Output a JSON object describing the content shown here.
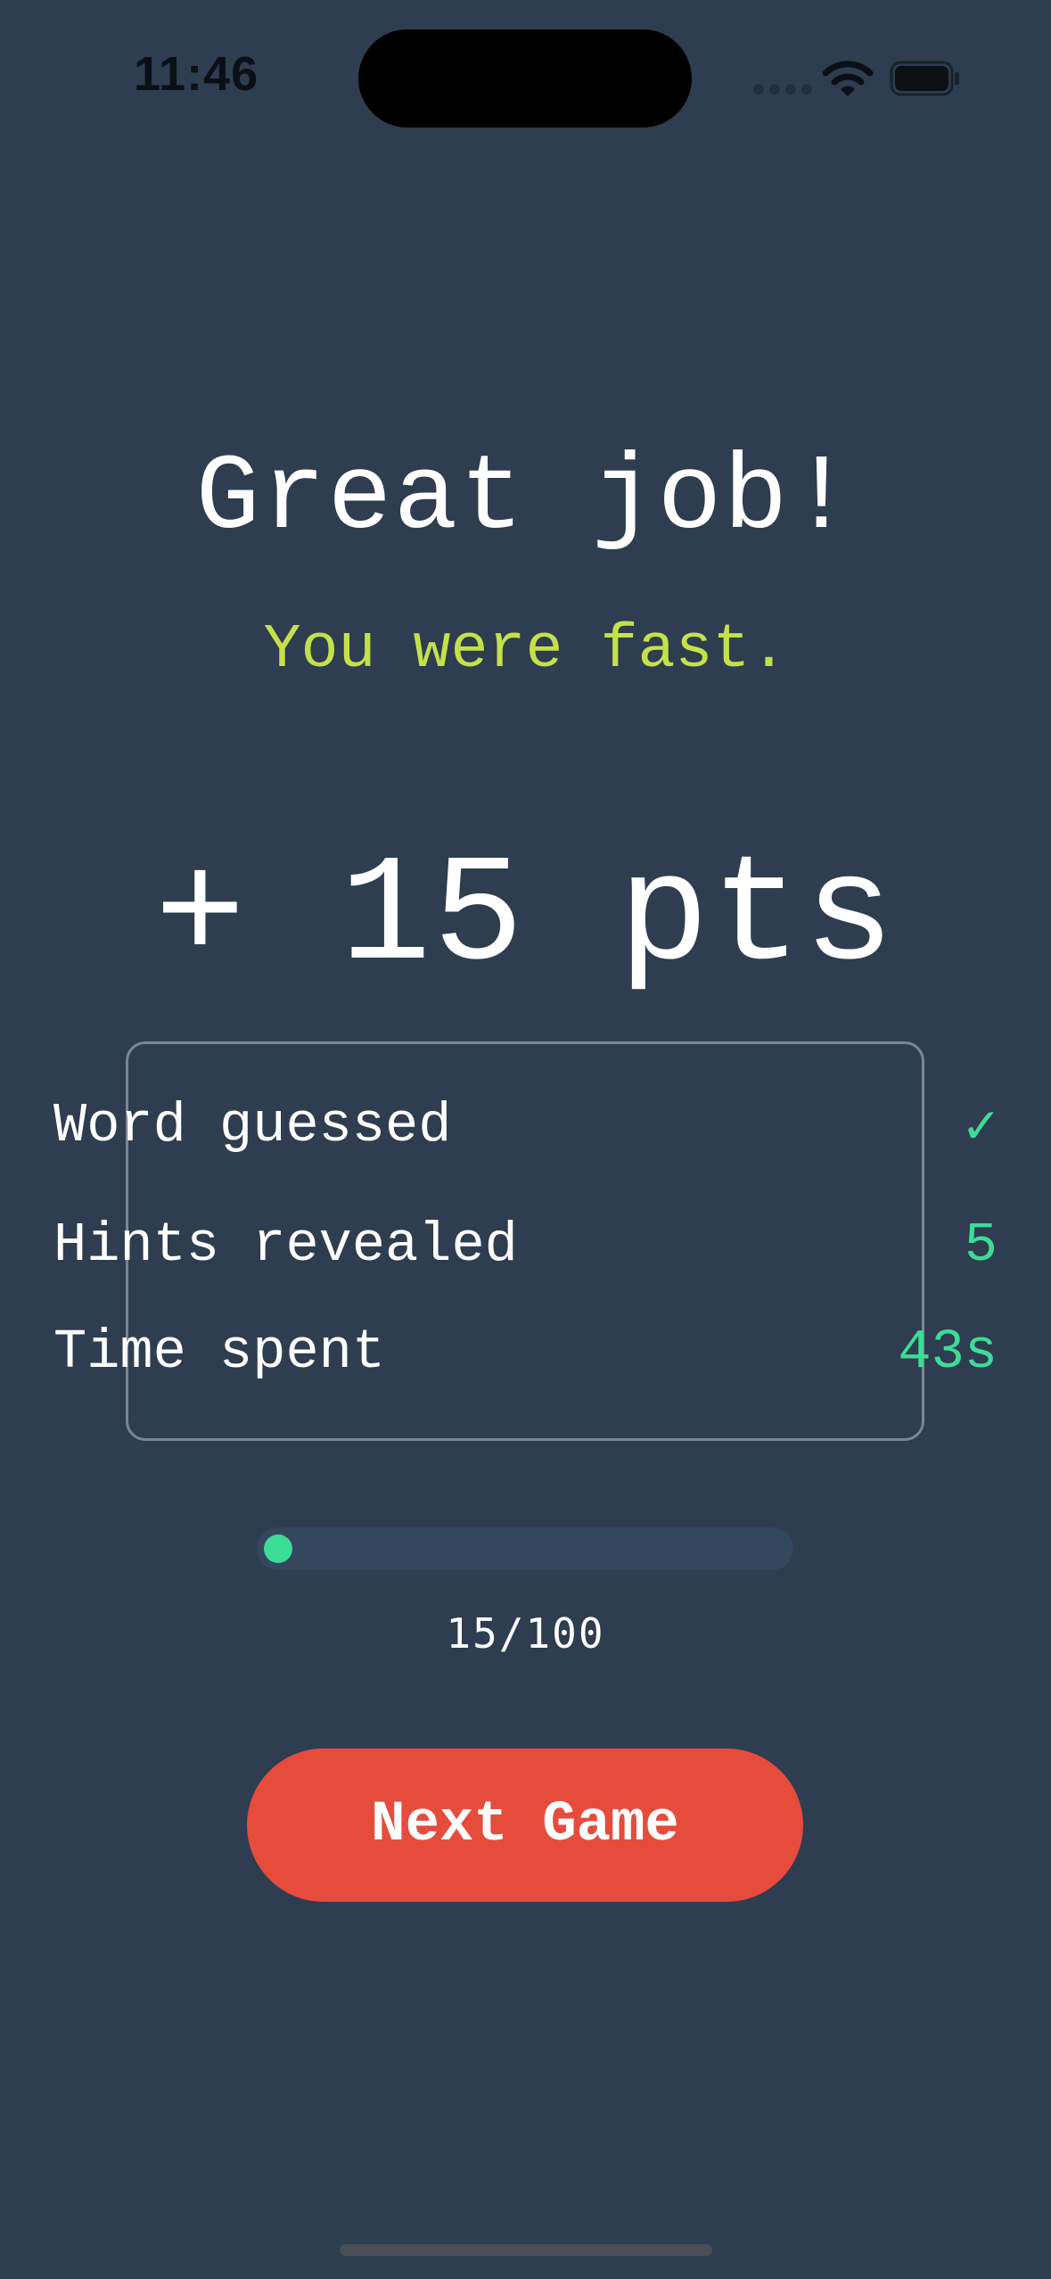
{
  "status_bar": {
    "time": "11:46",
    "icons": [
      "signal-dots-icon",
      "wifi-icon",
      "battery-icon"
    ]
  },
  "result": {
    "headline": "Great job!",
    "subheadline": "You were fast.",
    "score": "+ 15 pts"
  },
  "stats": [
    {
      "label": "Word guessed",
      "value": "✓"
    },
    {
      "label": "Hints revealed",
      "value": "5"
    },
    {
      "label": "Time spent",
      "value": "43s"
    }
  ],
  "progress": {
    "text": "15/100",
    "fraction": 0.15
  },
  "actions": {
    "next_label": "Next Game"
  },
  "colors": {
    "background": "#2e3d50",
    "accent_green": "#3ddc97",
    "subheadline": "#c5e04a",
    "button": "#e64c3c"
  }
}
